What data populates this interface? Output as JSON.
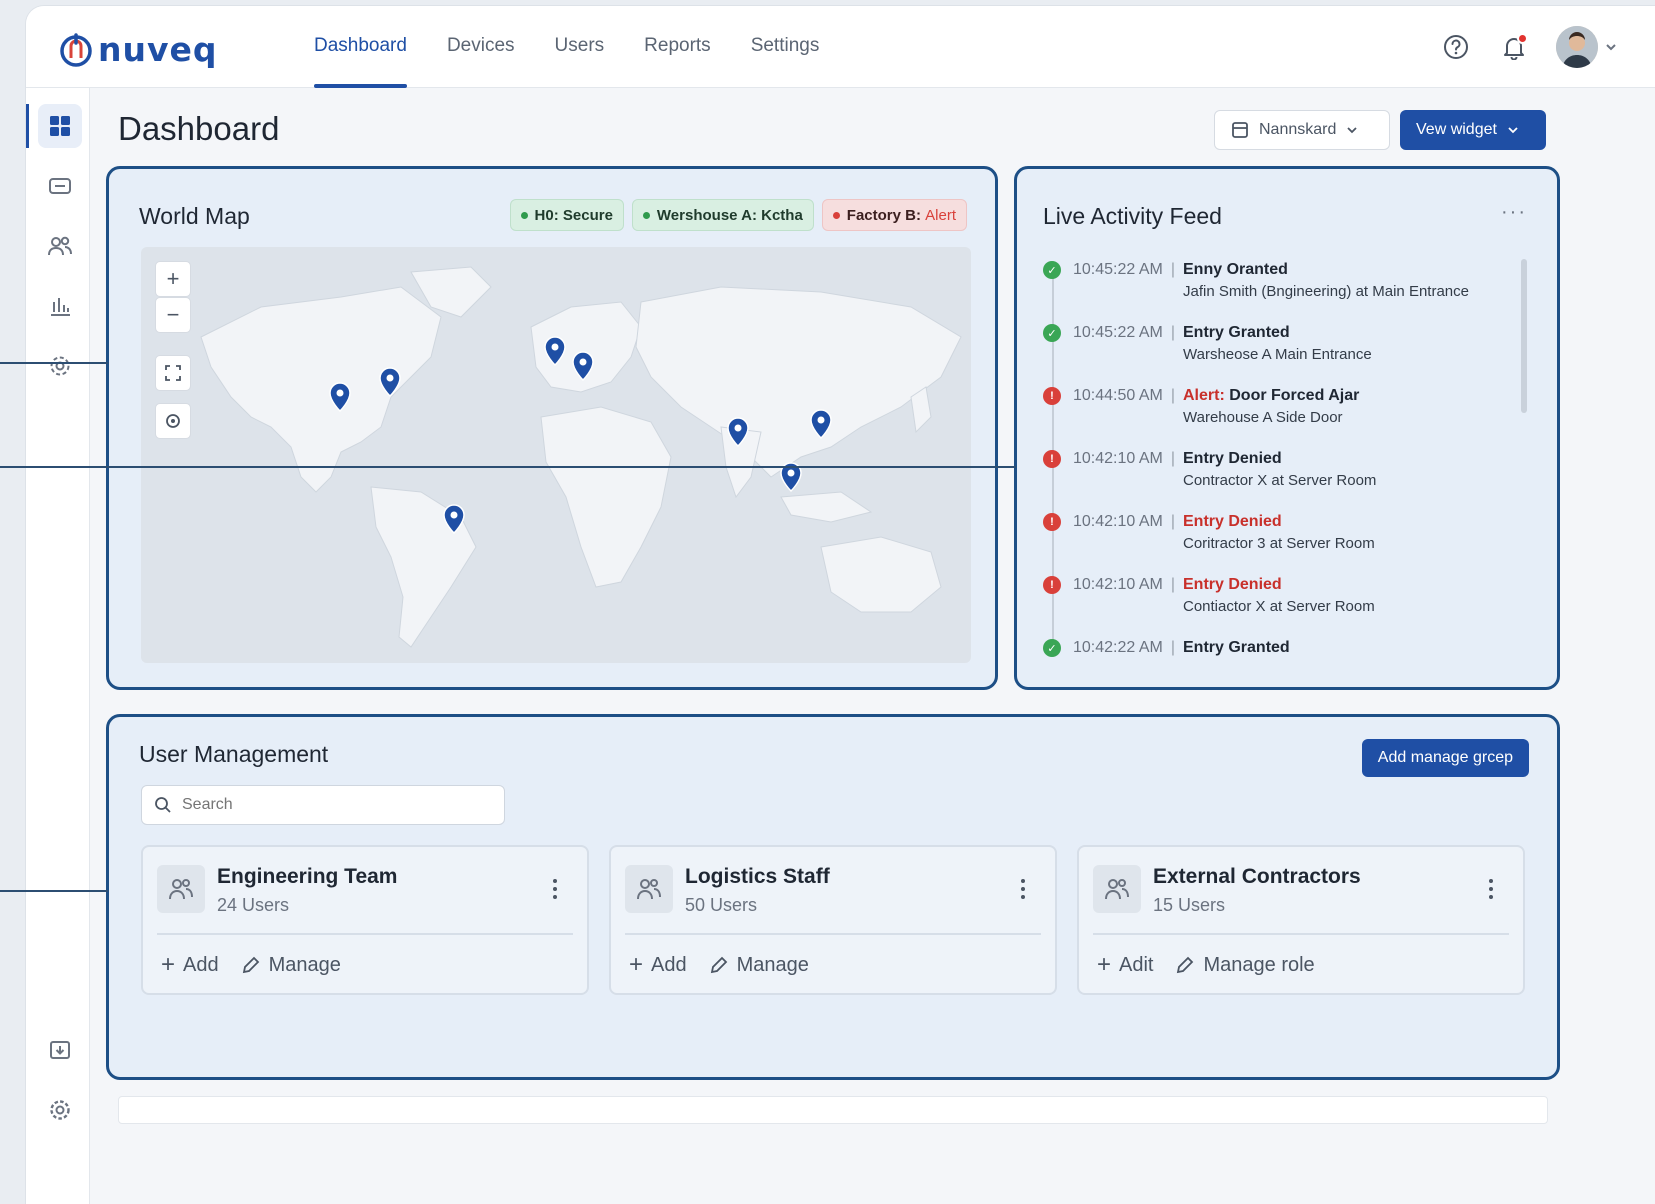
{
  "brand": {
    "name": "nuveq",
    "color": "#1f4fa5"
  },
  "nav": {
    "items": [
      {
        "label": "Dashboard",
        "active": true
      },
      {
        "label": "Devices",
        "active": false
      },
      {
        "label": "Users",
        "active": false
      },
      {
        "label": "Reports",
        "active": false
      },
      {
        "label": "Settings",
        "active": false
      }
    ]
  },
  "topbar": {
    "help_icon": "help-circle-icon",
    "notification_icon": "bell-icon",
    "has_notification": true
  },
  "sidebar": {
    "items": [
      {
        "icon": "grid-icon",
        "active": true
      },
      {
        "icon": "card-reader-icon",
        "active": false
      },
      {
        "icon": "users-icon",
        "active": false
      },
      {
        "icon": "bar-chart-icon",
        "active": false
      },
      {
        "icon": "cog-icon",
        "active": false
      }
    ],
    "bottom": [
      {
        "icon": "export-icon"
      },
      {
        "icon": "settings-icon"
      }
    ]
  },
  "page": {
    "title": "Dashboard",
    "layout_button": "Nannskard",
    "view_widget_button": "Vew widget"
  },
  "map": {
    "title": "World Map",
    "badges": [
      {
        "label": "H0: Secure",
        "status": "green"
      },
      {
        "label": "Wershouse A: Kctha",
        "status": "green"
      },
      {
        "label": "Factory B: ",
        "label_alert": "Alert",
        "status": "red"
      }
    ],
    "controls": {
      "zoom_in": "+",
      "zoom_out": "−"
    },
    "pins": [
      "north-america-west",
      "north-america-east",
      "europe-west",
      "europe-central",
      "south-america",
      "south-asia",
      "east-asia",
      "southeast-asia"
    ]
  },
  "feed": {
    "title": "Live Activity Feed",
    "more": "···",
    "items": [
      {
        "status": "ok",
        "time": "10:45:22 AM",
        "event": "Enny Oranted",
        "detail": "Jafin Smith (Bngineering) at Main Entrance"
      },
      {
        "status": "ok",
        "time": "10:45:22 AM",
        "event": "Entry Granted",
        "detail": "Warsheose A Main Entrance"
      },
      {
        "status": "bad",
        "time": "10:44:50 AM",
        "prefix": "Alert:",
        "event": "Door Forced Ajar",
        "detail": "Warehouse A Side Door"
      },
      {
        "status": "bad",
        "time": "10:42:10 AM",
        "event": "Entry Denied",
        "detail": "Contractor X at Server Room"
      },
      {
        "status": "bad",
        "time": "10:42:10 AM",
        "event": "Entry Denied",
        "red": true,
        "detail": "Coritractor 3 at Server Room"
      },
      {
        "status": "bad",
        "time": "10:42:10 AM",
        "event": "Entry Denied",
        "red": true,
        "detail": "Contiactor X at Server Room"
      },
      {
        "status": "ok",
        "time": "10:42:22 AM",
        "event": "Entry Granted",
        "detail": ""
      }
    ]
  },
  "users": {
    "title": "User Management",
    "add_button": "Add manage grcep",
    "search_placeholder": "Search",
    "groups": [
      {
        "name": "Engineering Team",
        "count": "24 Users",
        "add": "Add",
        "manage": "Manage"
      },
      {
        "name": "Logistics Staff",
        "count": "50 Users",
        "add": "Add",
        "manage": "Manage"
      },
      {
        "name": "External Contractors",
        "count": "15 Users",
        "add": "Adit",
        "manage": "Manage role"
      }
    ]
  },
  "colors": {
    "primary": "#1f4fa5",
    "panel_border": "#1d4f86",
    "ok": "#3aa655",
    "alert": "#d9403a"
  }
}
